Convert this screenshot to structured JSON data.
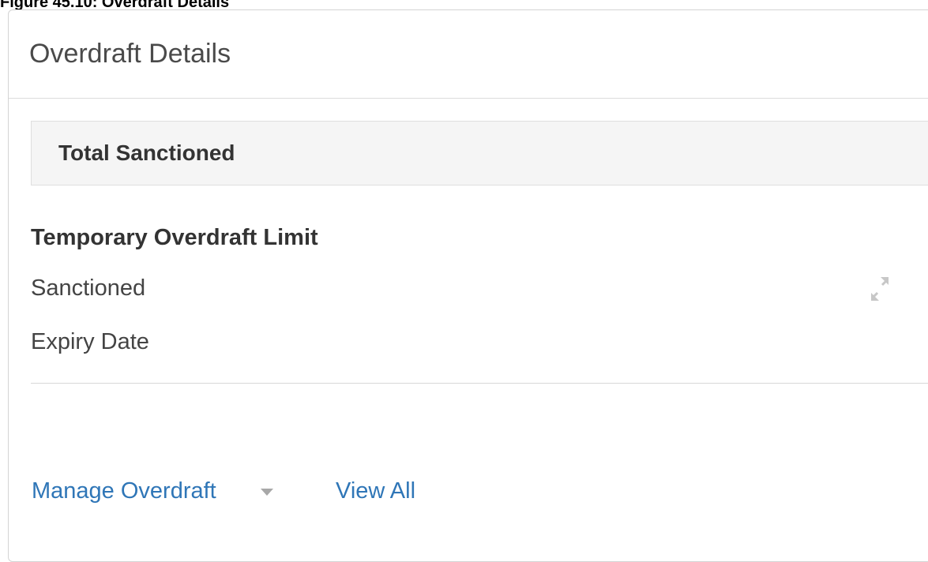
{
  "figure_caption": "Figure 45.10: Overdraft Details",
  "panel": {
    "title": "Overdraft Details",
    "total_sanctioned_label": "Total Sanctioned",
    "section_heading": "Temporary Overdraft Limit",
    "rows": [
      {
        "label": "Sanctioned"
      },
      {
        "label": "Expiry Date"
      }
    ],
    "expand_icon": "expand-icon"
  },
  "footer": {
    "manage_overdraft_label": "Manage Overdraft",
    "view_all_label": "View All",
    "dropdown_icon": "caret-down-icon"
  },
  "colors": {
    "link": "#2f76b7",
    "heading_text": "#333333",
    "muted_icon": "#a8a8a8"
  }
}
